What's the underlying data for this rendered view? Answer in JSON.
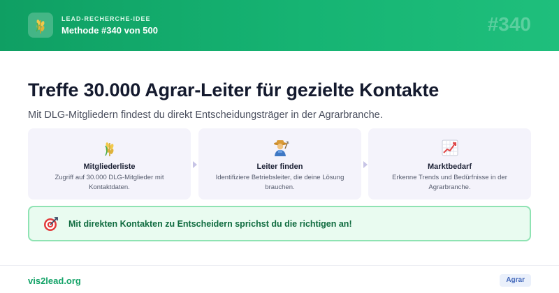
{
  "header": {
    "kicker": "LEAD-RECHERCHE-IDEE",
    "subtitle": "Methode #340 von 500",
    "number": "#340",
    "logo_icon": "wheat-icon"
  },
  "main": {
    "title": "Treffe 30.000 Agrar-Leiter für gezielte Kontakte",
    "subtitle": "Mit DLG-Mitgliedern findest du direkt Entscheidungsträger in der Agrarbranche."
  },
  "cards": [
    {
      "icon": "wheat-icon",
      "title": "Mitgliederliste",
      "desc": "Zugriff auf 30.000 DLG-Mitglieder mit Kontaktdaten."
    },
    {
      "icon": "farmer-icon",
      "title": "Leiter finden",
      "desc": "Identifiziere Betriebsleiter, die deine Lösung brauchen."
    },
    {
      "icon": "chart-increasing-icon",
      "title": "Marktbedarf",
      "desc": "Erkenne Trends und Bedürfnisse in der Agrarbranche."
    }
  ],
  "banner": {
    "icon": "target-icon",
    "text": "Mit direkten Kontakten zu Entscheidern sprichst du die richtigen an!"
  },
  "footer": {
    "link": "vis2lead.org",
    "tag": "Agrar"
  },
  "colors": {
    "brand_green": "#16b473",
    "card_bg": "#f4f3fb",
    "banner_bg": "#e9fbf0",
    "banner_border": "#8fe3b3",
    "tag_text": "#3e64b8"
  }
}
